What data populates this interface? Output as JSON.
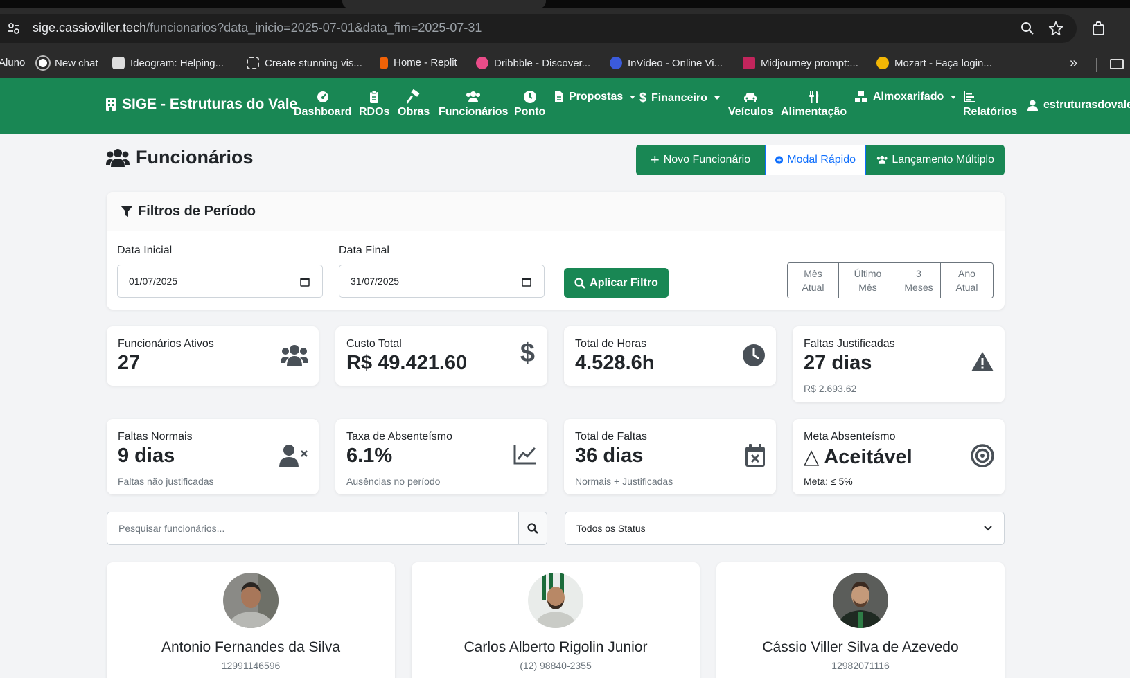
{
  "browser": {
    "url_host": "sige.cassioviller.tech",
    "url_path": "/funcionarios?data_inicio=2025-07-01&data_fim=2025-07-31",
    "bookmarks": [
      {
        "label": "Aluno"
      },
      {
        "label": "New chat"
      },
      {
        "label": "Ideogram: Helping..."
      },
      {
        "label": "Create stunning vis..."
      },
      {
        "label": "Home - Replit"
      },
      {
        "label": "Dribbble - Discover..."
      },
      {
        "label": "InVideo - Online Vi..."
      },
      {
        "label": "Midjourney prompt:..."
      },
      {
        "label": "Mozart - Faça login..."
      }
    ],
    "more": "»"
  },
  "navbar": {
    "brand": "SIGE - Estruturas do Vale",
    "items": [
      {
        "label": "Dashboard",
        "icon": "gauge-icon"
      },
      {
        "label": "RDOs",
        "icon": "clipboard-icon"
      },
      {
        "label": "Obras",
        "icon": "hammer-icon"
      },
      {
        "label": "Funcionários",
        "icon": "users-icon"
      },
      {
        "label": "Ponto",
        "icon": "clock-icon"
      },
      {
        "label": "Propostas",
        "icon": "file-icon"
      },
      {
        "label": "Financeiro",
        "icon": "dollar-icon"
      },
      {
        "label": "Veículos",
        "icon": "car-icon"
      },
      {
        "label": "Alimentação",
        "icon": "utensils-icon"
      },
      {
        "label": "Almoxarifado",
        "icon": "boxes-icon"
      },
      {
        "label": "Relatórios",
        "icon": "chart-bar-icon"
      }
    ],
    "user": "estruturasdovale"
  },
  "page": {
    "title": "Funcionários",
    "actions": {
      "new": "Novo Funcionário",
      "quick_modal": "Modal Rápido",
      "multi": "Lançamento Múltiplo"
    }
  },
  "filters": {
    "title": "Filtros de Período",
    "start_label": "Data Inicial",
    "start_value": "01/07/2025",
    "end_label": "Data Final",
    "end_value": "31/07/2025",
    "apply": "Aplicar Filtro",
    "quick": [
      {
        "line1": "Mês",
        "line2": "Atual"
      },
      {
        "line1": "Último",
        "line2": "Mês"
      },
      {
        "line1": "3",
        "line2": "Meses"
      },
      {
        "line1": "Ano",
        "line2": "Atual"
      }
    ]
  },
  "stats": [
    {
      "label": "Funcionários Ativos",
      "value": "27",
      "sub": "",
      "icon": "users-icon"
    },
    {
      "label": "Custo Total",
      "value": "R$ 49.421.60",
      "sub": "",
      "icon": "dollar-icon"
    },
    {
      "label": "Total de Horas",
      "value": "4.528.6h",
      "sub": "",
      "icon": "clock-icon"
    },
    {
      "label": "Faltas Justificadas",
      "value": "27 dias",
      "sub": "R$ 2.693.62",
      "icon": "warning-icon"
    },
    {
      "label": "Faltas Normais",
      "value": "9 dias",
      "sub": "Faltas não justificadas",
      "icon": "user-times-icon"
    },
    {
      "label": "Taxa de Absenteísmo",
      "value": "6.1%",
      "sub": "Ausências no período",
      "icon": "chart-line-icon"
    },
    {
      "label": "Total de Faltas",
      "value": "36 dias",
      "sub": "Normais + Justificadas",
      "icon": "calendar-times-icon"
    },
    {
      "label": "Meta Absenteísmo",
      "value": "△ Aceitável",
      "sub": "Meta: ≤ 5%",
      "icon": "target-icon"
    }
  ],
  "search": {
    "placeholder": "Pesquisar funcionários...",
    "status_value": "Todos os Status"
  },
  "employees": [
    {
      "name": "Antonio Fernandes da Silva",
      "phone": "12991146596"
    },
    {
      "name": "Carlos Alberto Rigolin Junior",
      "phone": "(12) 98840-2355"
    },
    {
      "name": "Cássio Viller Silva de Azevedo",
      "phone": "12982071116"
    }
  ],
  "colors": {
    "primary_green": "#198754",
    "outline_blue": "#0d6efd"
  }
}
